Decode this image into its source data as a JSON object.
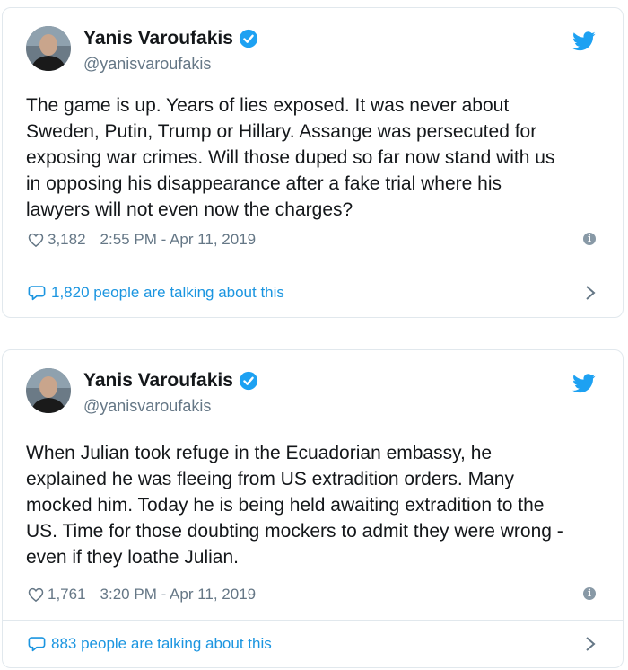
{
  "colors": {
    "text": "#14171a",
    "muted": "#657786",
    "link": "#1b95e0",
    "verified": "#1da1f2",
    "border": "#e1e8ed"
  },
  "tweets": [
    {
      "name": "Yanis Varoufakis",
      "handle": "@yanisvaroufakis",
      "lines": [
        "The game is up. Years of lies exposed. It was never about",
        "Sweden, Putin, Trump or Hillary. Assange was persecuted for",
        "exposing war crimes. Will those duped so far now stand with us",
        "in opposing his disappearance after a fake trial where his",
        "lawyers will not even now the charges?"
      ],
      "likes": "3,182",
      "timestamp": "2:55 PM - Apr 11, 2019",
      "talking": "1,820 people are talking about this"
    },
    {
      "name": "Yanis Varoufakis",
      "handle": "@yanisvaroufakis",
      "lines": [
        "When Julian took refuge in the Ecuadorian embassy, he",
        "explained he was fleeing from US extradition orders. Many",
        "mocked him. Today he is being held awaiting extradition to the",
        "US. Time for those doubting mockers to admit they were wrong -",
        "even if they loathe Julian."
      ],
      "likes": "1,761",
      "timestamp": "3:20 PM - Apr 11, 2019",
      "talking": "883 people are talking about this"
    }
  ]
}
